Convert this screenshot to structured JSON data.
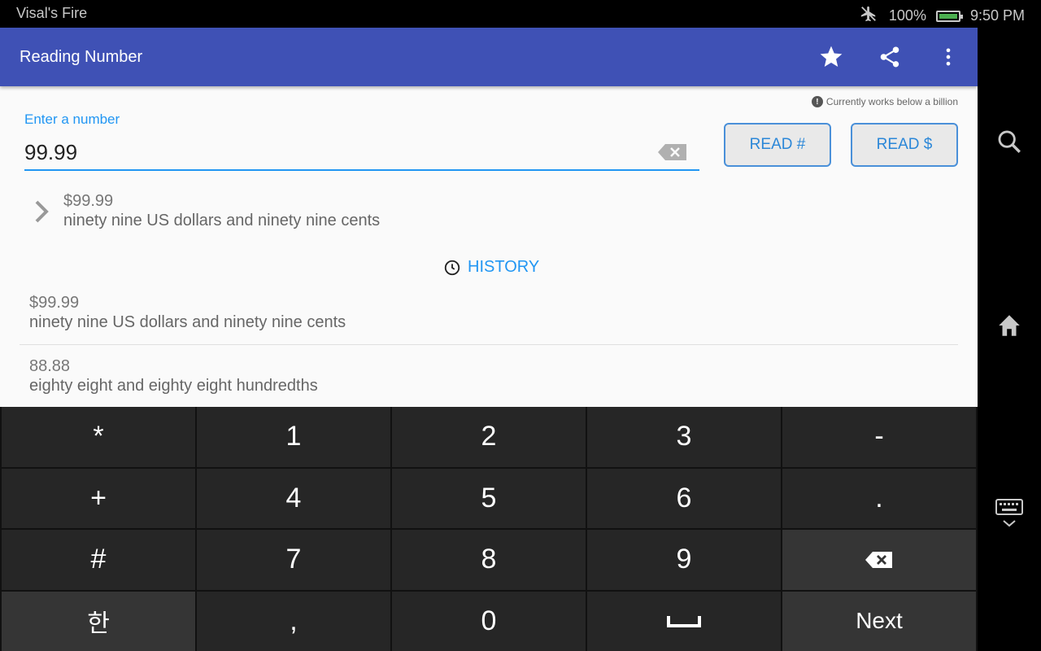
{
  "status": {
    "device_name": "Visal's Fire",
    "battery": "100%",
    "time": "9:50 PM"
  },
  "appbar": {
    "title": "Reading Number",
    "icons": [
      "star-icon",
      "share-icon",
      "more-vert-icon"
    ]
  },
  "note": "Currently works below a billion",
  "input": {
    "label": "Enter a number",
    "value": "99.99"
  },
  "buttons": {
    "read_number": "READ #",
    "read_dollar": "READ $"
  },
  "result": {
    "value": "$99.99",
    "words": "ninety nine US dollars and ninety nine cents"
  },
  "history": {
    "label": "HISTORY",
    "items": [
      {
        "value": "$99.99",
        "words": "ninety nine US dollars and ninety nine cents"
      },
      {
        "value": "88.88",
        "words": "eighty eight and eighty eight hundredths"
      }
    ]
  },
  "keyboard": {
    "keys": [
      "*",
      "1",
      "2",
      "3",
      "-",
      "+",
      "4",
      "5",
      "6",
      ".",
      "#",
      "7",
      "8",
      "9",
      "backspace",
      "한",
      ",",
      "0",
      "space",
      "Next"
    ]
  },
  "colors": {
    "primary": "#3f51b5",
    "accent": "#2196f3"
  }
}
